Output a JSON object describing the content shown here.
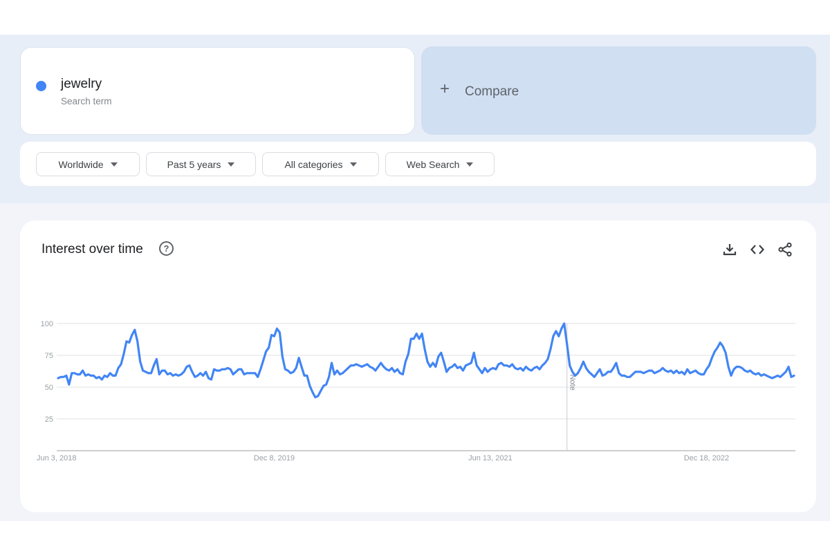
{
  "search_term": {
    "name": "jewelry",
    "subtitle": "Search term",
    "color": "#4285f4"
  },
  "compare": {
    "icon": "plus-icon",
    "label": "Compare"
  },
  "filters": [
    {
      "label": "Worldwide",
      "icon": "caret-down-icon"
    },
    {
      "label": "Past 5 years",
      "icon": "caret-down-icon"
    },
    {
      "label": "All categories",
      "icon": "caret-down-icon"
    },
    {
      "label": "Web Search",
      "icon": "caret-down-icon"
    }
  ],
  "chart_panel": {
    "title": "Interest over time",
    "help_icon": "help-circle-icon",
    "tools": [
      "download-icon",
      "embed-code-icon",
      "share-icon"
    ]
  },
  "chart_data": {
    "type": "line",
    "title": "Interest over time",
    "xlabel": "",
    "ylabel": "",
    "ylim": [
      0,
      100
    ],
    "yticks": [
      25,
      50,
      75,
      100
    ],
    "x_tick_labels": [
      "Jun 3, 2018",
      "Dec 8, 2019",
      "Jun 13, 2021",
      "Dec 18, 2022"
    ],
    "x_tick_week_index": [
      0,
      79,
      158,
      237
    ],
    "grid": true,
    "legend": "none",
    "annotations": [
      {
        "label": "Note",
        "week_index": 186
      }
    ],
    "series": [
      {
        "name": "jewelry",
        "color": "#4285f4",
        "values": [
          57,
          58,
          58,
          59,
          52,
          61,
          61,
          60,
          60,
          63,
          59,
          60,
          59,
          59,
          57,
          58,
          56,
          59,
          58,
          61,
          59,
          59,
          65,
          68,
          76,
          86,
          85,
          91,
          95,
          86,
          70,
          63,
          62,
          61,
          61,
          67,
          72,
          60,
          63,
          63,
          60,
          61,
          59,
          60,
          59,
          60,
          62,
          66,
          67,
          62,
          58,
          59,
          61,
          59,
          62,
          57,
          56,
          64,
          63,
          63,
          64,
          64,
          65,
          64,
          60,
          62,
          64,
          64,
          60,
          61,
          61,
          61,
          61,
          58,
          64,
          71,
          78,
          81,
          91,
          90,
          96,
          93,
          74,
          64,
          63,
          61,
          62,
          65,
          73,
          66,
          59,
          59,
          51,
          46,
          42,
          43,
          47,
          51,
          52,
          58,
          69,
          60,
          63,
          60,
          61,
          63,
          65,
          67,
          67,
          68,
          67,
          66,
          67,
          68,
          66,
          65,
          63,
          66,
          69,
          66,
          64,
          63,
          65,
          62,
          64,
          61,
          60,
          70,
          76,
          88,
          88,
          92,
          88,
          92,
          80,
          70,
          66,
          69,
          66,
          74,
          77,
          70,
          62,
          65,
          66,
          68,
          65,
          66,
          63,
          67,
          68,
          69,
          77,
          67,
          64,
          61,
          65,
          62,
          64,
          65,
          64,
          68,
          69,
          67,
          67,
          66,
          68,
          65,
          64,
          65,
          63,
          66,
          64,
          63,
          65,
          66,
          64,
          67,
          69,
          72,
          80,
          90,
          94,
          90,
          96,
          100,
          84,
          67,
          62,
          59,
          61,
          65,
          70,
          65,
          62,
          60,
          58,
          61,
          64,
          59,
          60,
          62,
          62,
          65,
          69,
          61,
          59,
          59,
          58,
          58,
          60,
          62,
          62,
          62,
          61,
          62,
          63,
          63,
          61,
          62,
          63,
          65,
          63,
          62,
          63,
          61,
          63,
          61,
          62,
          60,
          64,
          61,
          62,
          63,
          61,
          60,
          60,
          64,
          67,
          73,
          78,
          81,
          85,
          82,
          77,
          66,
          59,
          64,
          66,
          66,
          65,
          63,
          62,
          63,
          61,
          60,
          61,
          59,
          60,
          59,
          58,
          57,
          58,
          59,
          58,
          60,
          62,
          66,
          58,
          59
        ]
      }
    ]
  }
}
